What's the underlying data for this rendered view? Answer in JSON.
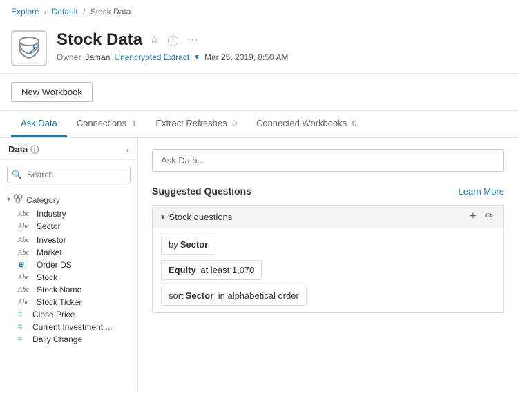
{
  "breadcrumb": {
    "explore": "Explore",
    "default": "Default",
    "current": "Stock Data"
  },
  "header": {
    "title": "Stock Data",
    "owner_label": "Owner",
    "owner_name": "Jaman",
    "extract_link": "Unencrypted Extract",
    "date": "Mar 25, 2019, 8:50 AM"
  },
  "new_workbook_btn": "New Workbook",
  "tabs": [
    {
      "label": "Ask Data",
      "active": true,
      "badge": null
    },
    {
      "label": "Connections",
      "active": false,
      "badge": "1"
    },
    {
      "label": "Extract Refreshes",
      "active": false,
      "badge": "0"
    },
    {
      "label": "Connected Workbooks",
      "active": false,
      "badge": "0"
    }
  ],
  "sidebar": {
    "title": "Data",
    "search_placeholder": "Search",
    "category": {
      "label": "Category",
      "items": [
        "Industry",
        "Sector"
      ]
    },
    "flat_items": [
      {
        "name": "Investor",
        "type": "Abc"
      },
      {
        "name": "Market",
        "type": "Abc"
      },
      {
        "name": "Order DS",
        "type": "db"
      },
      {
        "name": "Stock",
        "type": "Abc"
      },
      {
        "name": "Stock Name",
        "type": "Abc"
      },
      {
        "name": "Stock Ticker",
        "type": "Abc"
      }
    ],
    "numeric_items": [
      {
        "name": "Close Price",
        "type": "#"
      },
      {
        "name": "Current Investment ...",
        "type": "#"
      },
      {
        "name": "Daily Change",
        "type": "#"
      }
    ]
  },
  "right_panel": {
    "ask_data_placeholder": "Ask Data...",
    "suggested_title": "Suggested Questions",
    "learn_more": "Learn More",
    "accordion": {
      "title": "Stock questions",
      "suggestions": [
        {
          "prefix": "by",
          "bold": "Sector",
          "suffix": ""
        },
        {
          "prefix": "",
          "bold": "Equity",
          "suffix": "at least 1,070"
        },
        {
          "prefix": "sort",
          "bold": "Sector",
          "suffix": "in alphabetical order"
        }
      ]
    }
  }
}
